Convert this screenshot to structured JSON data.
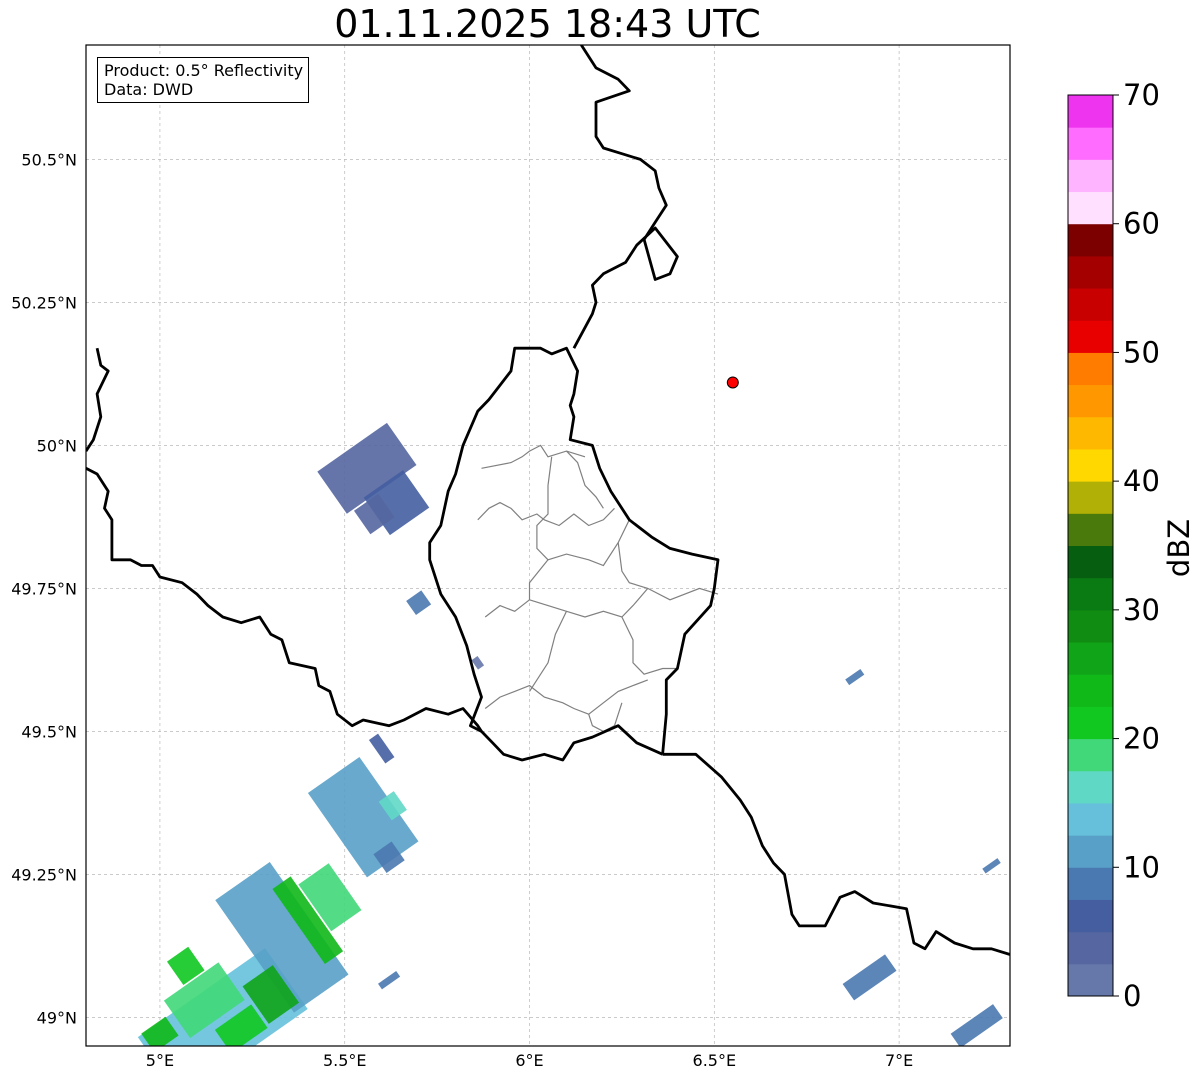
{
  "title": "01.11.2025 18:43 UTC",
  "info": {
    "product": "Product: 0.5° Reflectivity",
    "data": "Data: DWD"
  },
  "axes": {
    "lon_range": [
      4.8,
      7.3
    ],
    "lat_range": [
      48.95,
      50.7
    ],
    "x_ticks": [
      {
        "value": 5.0,
        "label": "5°E"
      },
      {
        "value": 5.5,
        "label": "5.5°E"
      },
      {
        "value": 6.0,
        "label": "6°E"
      },
      {
        "value": 6.5,
        "label": "6.5°E"
      },
      {
        "value": 7.0,
        "label": "7°E"
      }
    ],
    "y_ticks": [
      {
        "value": 49.0,
        "label": "49°N"
      },
      {
        "value": 49.25,
        "label": "49.25°N"
      },
      {
        "value": 49.5,
        "label": "49.5°N"
      },
      {
        "value": 49.75,
        "label": "49.75°N"
      },
      {
        "value": 50.0,
        "label": "50°N"
      },
      {
        "value": 50.25,
        "label": "50.25°N"
      },
      {
        "value": 50.5,
        "label": "50.5°N"
      }
    ],
    "grid": true
  },
  "marker": {
    "lon": 6.55,
    "lat": 50.11,
    "color": "#ff0000"
  },
  "colorbar": {
    "label": "dBZ",
    "min": 0,
    "max": 70,
    "step": 2.5,
    "tick_values": [
      0,
      10,
      20,
      30,
      40,
      50,
      60,
      70
    ],
    "tick_labels": [
      "0",
      "10",
      "20",
      "30",
      "40",
      "50",
      "60",
      "70"
    ],
    "colors": [
      "#6677aa",
      "#5566a0",
      "#445ea0",
      "#4a78b0",
      "#58a0c8",
      "#66c0dc",
      "#60d8c6",
      "#40d878",
      "#10c820",
      "#10b818",
      "#10a418",
      "#108c12",
      "#0a7a12",
      "#065e10",
      "#4a7a0c",
      "#b0b006",
      "#ffd800",
      "#ffb800",
      "#ff9800",
      "#ff7c00",
      "#e80000",
      "#c80000",
      "#a40000",
      "#7c0000",
      "#ffe0ff",
      "#ffb4ff",
      "#ff6cff",
      "#ee34ee"
    ]
  },
  "borders": {
    "national": [
      [
        [
          4.83,
          50.17
        ],
        [
          4.84,
          50.14
        ],
        [
          4.86,
          50.13
        ],
        [
          4.83,
          50.09
        ],
        [
          4.84,
          50.05
        ],
        [
          4.82,
          50.01
        ],
        [
          4.8,
          49.99
        ]
      ],
      [
        [
          4.8,
          49.96
        ],
        [
          4.83,
          49.95
        ],
        [
          4.86,
          49.92
        ],
        [
          4.85,
          49.89
        ],
        [
          4.87,
          49.87
        ],
        [
          4.87,
          49.8
        ],
        [
          4.92,
          49.8
        ],
        [
          4.95,
          49.79
        ],
        [
          4.98,
          49.79
        ],
        [
          5.0,
          49.77
        ],
        [
          5.06,
          49.76
        ],
        [
          5.1,
          49.74
        ],
        [
          5.13,
          49.72
        ],
        [
          5.17,
          49.7
        ],
        [
          5.22,
          49.69
        ],
        [
          5.27,
          49.7
        ],
        [
          5.3,
          49.67
        ],
        [
          5.33,
          49.66
        ],
        [
          5.35,
          49.62
        ],
        [
          5.42,
          49.61
        ],
        [
          5.43,
          49.58
        ],
        [
          5.46,
          49.57
        ],
        [
          5.48,
          49.53
        ],
        [
          5.52,
          49.51
        ],
        [
          5.55,
          49.52
        ],
        [
          5.62,
          49.51
        ],
        [
          5.66,
          49.52
        ],
        [
          5.72,
          49.54
        ],
        [
          5.78,
          49.53
        ],
        [
          5.82,
          49.54
        ],
        [
          5.86,
          49.51
        ],
        [
          5.87,
          49.5
        ],
        [
          5.9,
          49.48
        ],
        [
          5.93,
          49.46
        ],
        [
          5.98,
          49.45
        ],
        [
          6.04,
          49.46
        ],
        [
          6.09,
          49.45
        ],
        [
          6.12,
          49.48
        ],
        [
          6.17,
          49.49
        ],
        [
          6.24,
          49.51
        ],
        [
          6.29,
          49.48
        ],
        [
          6.36,
          49.46
        ]
      ],
      [
        [
          5.87,
          49.5
        ],
        [
          5.84,
          49.51
        ],
        [
          5.87,
          49.56
        ],
        [
          5.85,
          49.6
        ],
        [
          5.83,
          49.65
        ],
        [
          5.8,
          49.7
        ],
        [
          5.76,
          49.74
        ],
        [
          5.73,
          49.8
        ],
        [
          5.73,
          49.83
        ],
        [
          5.76,
          49.86
        ],
        [
          5.78,
          49.92
        ],
        [
          5.8,
          49.95
        ],
        [
          5.82,
          50.0
        ],
        [
          5.86,
          50.06
        ],
        [
          5.89,
          50.08
        ],
        [
          5.95,
          50.13
        ],
        [
          5.96,
          50.17
        ],
        [
          6.03,
          50.17
        ],
        [
          6.06,
          50.16
        ],
        [
          6.1,
          50.17
        ],
        [
          6.13,
          50.13
        ],
        [
          6.12,
          50.09
        ],
        [
          6.11,
          50.07
        ],
        [
          6.12,
          50.05
        ],
        [
          6.11,
          50.01
        ],
        [
          6.17,
          50.0
        ],
        [
          6.19,
          49.96
        ],
        [
          6.22,
          49.92
        ],
        [
          6.24,
          49.9
        ],
        [
          6.27,
          49.87
        ],
        [
          6.33,
          49.84
        ],
        [
          6.38,
          49.82
        ],
        [
          6.44,
          49.81
        ],
        [
          6.51,
          49.8
        ],
        [
          6.5,
          49.75
        ],
        [
          6.49,
          49.72
        ],
        [
          6.42,
          49.67
        ],
        [
          6.4,
          49.61
        ],
        [
          6.37,
          49.59
        ],
        [
          6.37,
          49.53
        ],
        [
          6.36,
          49.46
        ]
      ],
      [
        [
          6.12,
          50.17
        ],
        [
          6.17,
          50.23
        ],
        [
          6.18,
          50.25
        ],
        [
          6.17,
          50.28
        ],
        [
          6.2,
          50.3
        ],
        [
          6.26,
          50.32
        ],
        [
          6.29,
          50.35
        ],
        [
          6.34,
          50.38
        ],
        [
          6.4,
          50.33
        ],
        [
          6.38,
          50.3
        ],
        [
          6.34,
          50.29
        ],
        [
          6.31,
          50.36
        ],
        [
          6.34,
          50.39
        ],
        [
          6.37,
          50.42
        ],
        [
          6.35,
          50.45
        ],
        [
          6.34,
          50.48
        ],
        [
          6.3,
          50.5
        ],
        [
          6.25,
          50.51
        ],
        [
          6.2,
          50.52
        ],
        [
          6.18,
          50.54
        ],
        [
          6.18,
          50.6
        ],
        [
          6.27,
          50.62
        ],
        [
          6.24,
          50.64
        ],
        [
          6.18,
          50.66
        ],
        [
          6.14,
          50.7
        ]
      ],
      [
        [
          6.36,
          49.46
        ],
        [
          6.45,
          49.46
        ],
        [
          6.52,
          49.42
        ],
        [
          6.57,
          49.38
        ],
        [
          6.6,
          49.35
        ],
        [
          6.63,
          49.3
        ],
        [
          6.66,
          49.27
        ],
        [
          6.69,
          49.25
        ],
        [
          6.71,
          49.18
        ],
        [
          6.73,
          49.16
        ],
        [
          6.8,
          49.16
        ],
        [
          6.84,
          49.21
        ],
        [
          6.88,
          49.22
        ],
        [
          6.93,
          49.2
        ],
        [
          7.02,
          49.19
        ],
        [
          7.04,
          49.13
        ],
        [
          7.07,
          49.12
        ],
        [
          7.1,
          49.15
        ],
        [
          7.15,
          49.13
        ],
        [
          7.2,
          49.12
        ],
        [
          7.25,
          49.12
        ],
        [
          7.3,
          49.11
        ]
      ]
    ],
    "districts": [
      [
        [
          5.87,
          49.96
        ],
        [
          5.95,
          49.97
        ],
        [
          5.98,
          49.98
        ],
        [
          6.0,
          49.99
        ],
        [
          6.03,
          50.0
        ],
        [
          6.05,
          49.98
        ],
        [
          6.1,
          49.99
        ],
        [
          6.15,
          49.98
        ]
      ],
      [
        [
          5.86,
          49.87
        ],
        [
          5.89,
          49.89
        ],
        [
          5.92,
          49.9
        ],
        [
          5.95,
          49.89
        ],
        [
          5.98,
          49.87
        ],
        [
          6.02,
          49.88
        ],
        [
          6.04,
          49.87
        ],
        [
          6.08,
          49.86
        ],
        [
          6.12,
          49.88
        ],
        [
          6.16,
          49.86
        ],
        [
          6.2,
          49.87
        ],
        [
          6.23,
          49.89
        ]
      ],
      [
        [
          6.06,
          49.98
        ],
        [
          6.05,
          49.93
        ],
        [
          6.05,
          49.88
        ],
        [
          6.02,
          49.86
        ],
        [
          6.02,
          49.82
        ],
        [
          6.05,
          49.8
        ],
        [
          6.1,
          49.81
        ],
        [
          6.16,
          49.8
        ],
        [
          6.2,
          49.79
        ],
        [
          6.24,
          49.83
        ],
        [
          6.27,
          49.87
        ]
      ],
      [
        [
          6.1,
          49.99
        ],
        [
          6.13,
          49.97
        ],
        [
          6.15,
          49.93
        ],
        [
          6.18,
          49.91
        ],
        [
          6.2,
          49.89
        ]
      ],
      [
        [
          6.24,
          49.83
        ],
        [
          6.25,
          49.78
        ],
        [
          6.27,
          49.76
        ],
        [
          6.32,
          49.75
        ],
        [
          6.38,
          49.73
        ],
        [
          6.46,
          49.75
        ],
        [
          6.51,
          49.74
        ]
      ],
      [
        [
          6.05,
          49.8
        ],
        [
          6.0,
          49.76
        ],
        [
          6.0,
          49.73
        ],
        [
          6.05,
          49.72
        ],
        [
          6.1,
          49.71
        ],
        [
          6.15,
          49.7
        ],
        [
          6.2,
          49.71
        ],
        [
          6.25,
          49.7
        ],
        [
          6.28,
          49.72
        ],
        [
          6.32,
          49.75
        ]
      ],
      [
        [
          6.0,
          49.73
        ],
        [
          5.96,
          49.71
        ],
        [
          5.92,
          49.72
        ],
        [
          5.88,
          49.7
        ]
      ],
      [
        [
          6.1,
          49.71
        ],
        [
          6.07,
          49.67
        ],
        [
          6.05,
          49.62
        ],
        [
          6.02,
          49.59
        ],
        [
          6.0,
          49.57
        ]
      ],
      [
        [
          6.25,
          49.7
        ],
        [
          6.28,
          49.66
        ],
        [
          6.28,
          49.62
        ],
        [
          6.31,
          49.6
        ],
        [
          6.36,
          49.61
        ],
        [
          6.4,
          49.61
        ]
      ],
      [
        [
          5.88,
          49.54
        ],
        [
          5.92,
          49.56
        ],
        [
          5.96,
          49.57
        ],
        [
          6.0,
          49.58
        ],
        [
          6.04,
          49.56
        ],
        [
          6.09,
          49.55
        ],
        [
          6.12,
          49.54
        ],
        [
          6.16,
          49.53
        ],
        [
          6.2,
          49.55
        ],
        [
          6.24,
          49.57
        ],
        [
          6.28,
          49.58
        ],
        [
          6.32,
          49.59
        ]
      ],
      [
        [
          6.16,
          49.53
        ],
        [
          6.17,
          49.51
        ],
        [
          6.2,
          49.5
        ],
        [
          6.23,
          49.51
        ],
        [
          6.25,
          49.55
        ]
      ]
    ]
  },
  "echoes": [
    {
      "lon": 5.56,
      "lat": 49.96,
      "w": 0.23,
      "h": 0.09,
      "color": "#5566a0"
    },
    {
      "lon": 5.64,
      "lat": 49.9,
      "w": 0.13,
      "h": 0.08,
      "color": "#445ea0"
    },
    {
      "lon": 5.58,
      "lat": 49.88,
      "w": 0.08,
      "h": 0.05,
      "color": "#5566a0"
    },
    {
      "lon": 5.7,
      "lat": 49.725,
      "w": 0.05,
      "h": 0.03,
      "color": "#4a78b0"
    },
    {
      "lon": 5.86,
      "lat": 49.62,
      "w": 0.02,
      "h": 0.02,
      "color": "#6677aa"
    },
    {
      "lon": 6.88,
      "lat": 49.595,
      "w": 0.05,
      "h": 0.012,
      "color": "#4a78b0"
    },
    {
      "lon": 6.92,
      "lat": 49.07,
      "w": 0.14,
      "h": 0.035,
      "color": "#4a78b0"
    },
    {
      "lon": 7.21,
      "lat": 48.985,
      "w": 0.14,
      "h": 0.03,
      "color": "#4a78b0"
    },
    {
      "lon": 7.25,
      "lat": 49.265,
      "w": 0.05,
      "h": 0.01,
      "color": "#4a78b0"
    },
    {
      "lon": 5.17,
      "lat": 48.99,
      "w": 0.42,
      "h": 0.13,
      "color": "#66c0dc"
    },
    {
      "lon": 5.33,
      "lat": 49.14,
      "w": 0.18,
      "h": 0.24,
      "color": "#58a0c8"
    },
    {
      "lon": 5.55,
      "lat": 49.35,
      "w": 0.17,
      "h": 0.18,
      "color": "#58a0c8"
    },
    {
      "lon": 5.46,
      "lat": 49.21,
      "w": 0.1,
      "h": 0.1,
      "color": "#40d878"
    },
    {
      "lon": 5.4,
      "lat": 49.17,
      "w": 0.06,
      "h": 0.16,
      "color": "#10b818"
    },
    {
      "lon": 5.12,
      "lat": 49.03,
      "w": 0.18,
      "h": 0.08,
      "color": "#40d878"
    },
    {
      "lon": 5.07,
      "lat": 49.09,
      "w": 0.07,
      "h": 0.05,
      "color": "#10c820"
    },
    {
      "lon": 5.3,
      "lat": 49.04,
      "w": 0.1,
      "h": 0.08,
      "color": "#10a418"
    },
    {
      "lon": 5.22,
      "lat": 48.98,
      "w": 0.12,
      "h": 0.05,
      "color": "#10c820"
    },
    {
      "lon": 5.0,
      "lat": 48.97,
      "w": 0.08,
      "h": 0.04,
      "color": "#10b818"
    },
    {
      "lon": 5.63,
      "lat": 49.37,
      "w": 0.05,
      "h": 0.04,
      "color": "#60d8c6"
    },
    {
      "lon": 5.62,
      "lat": 49.28,
      "w": 0.06,
      "h": 0.04,
      "color": "#4a78b0"
    },
    {
      "lon": 5.6,
      "lat": 49.47,
      "w": 0.03,
      "h": 0.05,
      "color": "#445ea0"
    },
    {
      "lon": 5.62,
      "lat": 49.065,
      "w": 0.06,
      "h": 0.012,
      "color": "#4a78b0"
    }
  ]
}
